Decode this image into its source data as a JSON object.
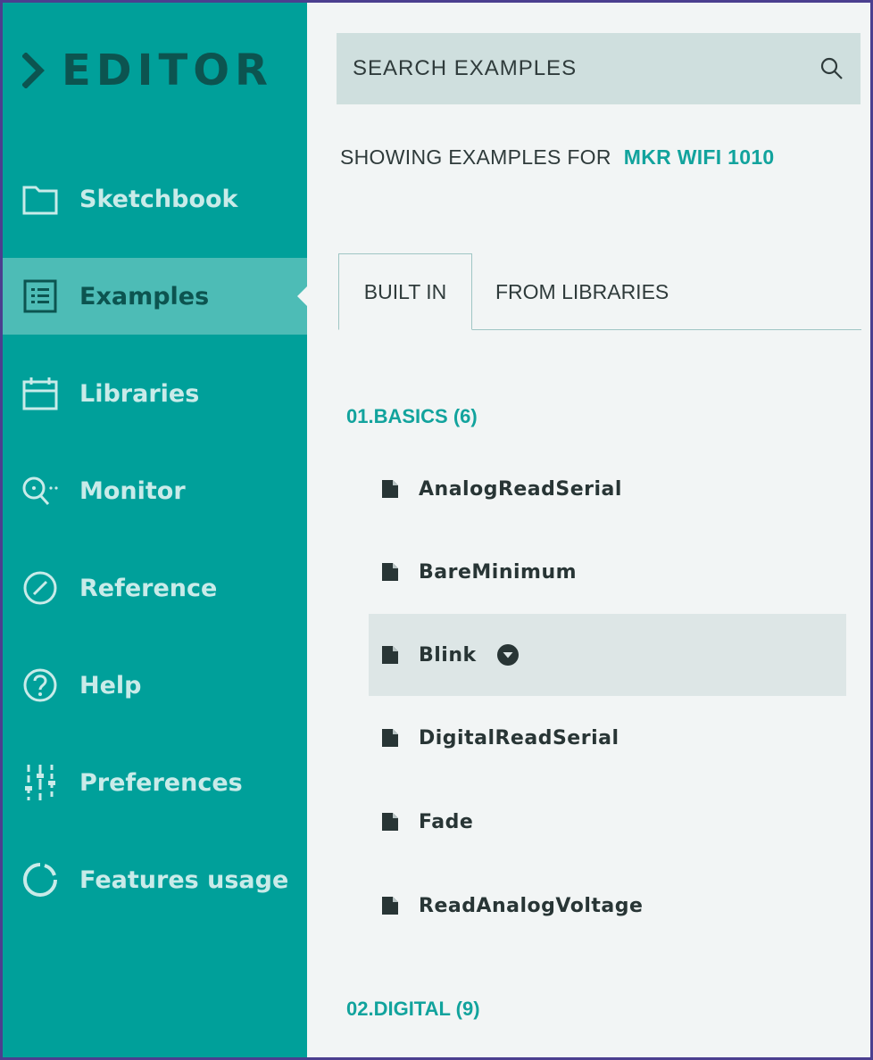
{
  "app": {
    "logo_text": "EDITOR"
  },
  "sidebar": {
    "items": [
      {
        "label": "Sketchbook",
        "icon": "folder-icon"
      },
      {
        "label": "Examples",
        "icon": "list-icon",
        "active": true
      },
      {
        "label": "Libraries",
        "icon": "libraries-icon"
      },
      {
        "label": "Monitor",
        "icon": "monitor-search-icon"
      },
      {
        "label": "Reference",
        "icon": "compass-icon"
      },
      {
        "label": "Help",
        "icon": "help-circle-icon"
      },
      {
        "label": "Preferences",
        "icon": "sliders-icon"
      },
      {
        "label": "Features usage",
        "icon": "usage-ring-icon"
      }
    ]
  },
  "search": {
    "placeholder": "SEARCH EXAMPLES",
    "icon": "search-icon"
  },
  "showing": {
    "prefix": "SHOWING EXAMPLES FOR",
    "board": "MKR WIFI 1010"
  },
  "tabs": [
    {
      "label": "BUILT IN",
      "active": true
    },
    {
      "label": "FROM LIBRARIES",
      "active": false
    }
  ],
  "sections": [
    {
      "heading": "01.BASICS (6)",
      "examples": [
        {
          "label": "AnalogReadSerial"
        },
        {
          "label": "BareMinimum"
        },
        {
          "label": "Blink",
          "selected": true
        },
        {
          "label": "DigitalReadSerial"
        },
        {
          "label": "Fade"
        },
        {
          "label": "ReadAnalogVoltage"
        }
      ]
    },
    {
      "heading": "02.DIGITAL (9)"
    }
  ],
  "colors": {
    "sidebar_bg": "#00a09a",
    "sidebar_active_bg": "#4dbcb6",
    "accent_teal": "#12a39d",
    "dark_teal": "#0c5450",
    "content_bg": "#f2f5f5",
    "search_bg": "#cfdfde",
    "frame_border": "#4b3f8f"
  }
}
